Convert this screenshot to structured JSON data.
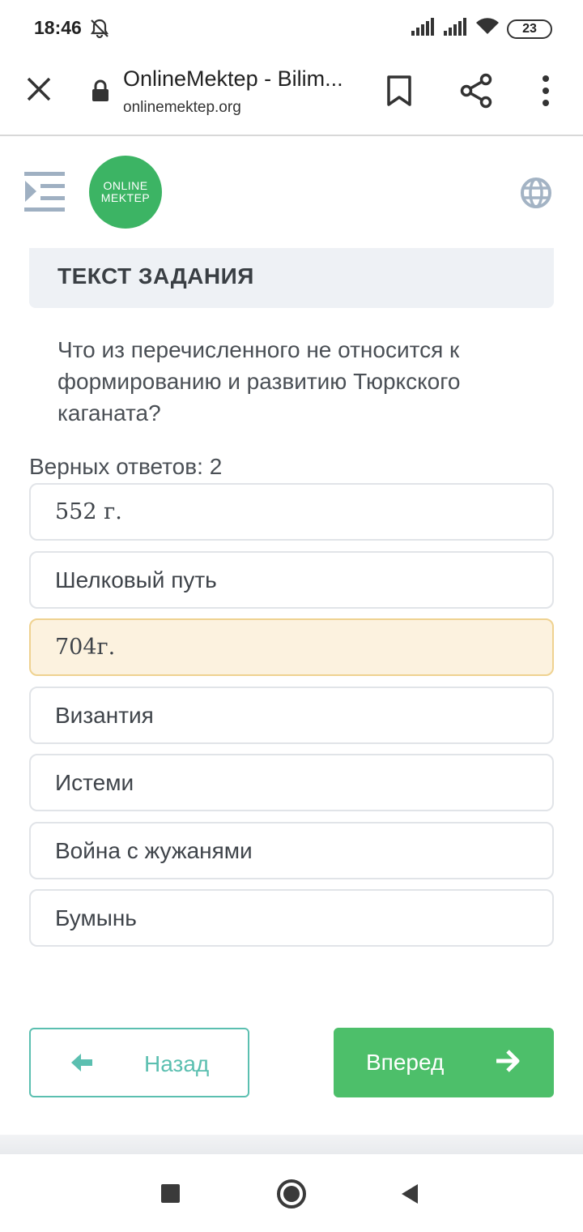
{
  "status_bar": {
    "time": "18:46",
    "battery": "23"
  },
  "browser": {
    "title": "OnlineMektep - Bilim...",
    "url": "onlinemektep.org"
  },
  "site": {
    "logo_line1": "ONLINE",
    "logo_line2": "MEKTEP"
  },
  "task": {
    "header": "ТЕКСТ ЗАДАНИЯ",
    "question": "Что из перечисленного не относится к формированию и развитию Тюркского каганата?",
    "answers_count": "Верных ответов: 2",
    "answers": [
      {
        "label": "552 г.",
        "selected": false
      },
      {
        "label": "Шелковый путь",
        "selected": false
      },
      {
        "label": "704г.",
        "selected": true
      },
      {
        "label": "Византия",
        "selected": false
      },
      {
        "label": "Истеми",
        "selected": false
      },
      {
        "label": "Война с жужанями",
        "selected": false
      },
      {
        "label": "Бумынь",
        "selected": false
      }
    ]
  },
  "nav": {
    "back_label": "Назад",
    "next_label": "Вперед"
  },
  "colors": {
    "brand_green": "#3cb464",
    "selected_bg": "#fcf2df",
    "back_teal": "#5bbfb0",
    "next_green": "#4dbf6a"
  }
}
